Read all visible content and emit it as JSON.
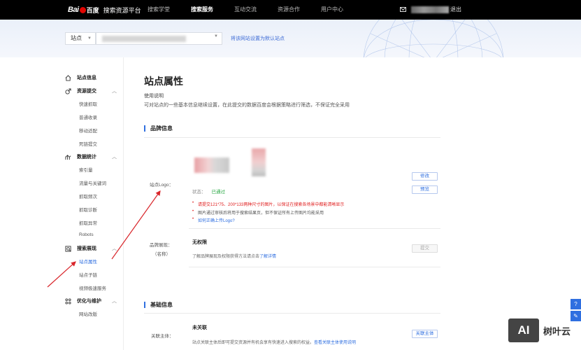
{
  "header": {
    "logo_bai": "Bai",
    "logo_du": "百度",
    "product_title": "搜索资源平台",
    "nav": [
      "搜索学堂",
      "搜索服务",
      "互动交流",
      "资源合作",
      "用户中心"
    ],
    "active_nav": "搜索服务",
    "logout": "退出"
  },
  "site_bar": {
    "select_label": "站点",
    "set_default_link": "将该网站设置为默认站点"
  },
  "sidebar": {
    "groups": [
      {
        "label": "站点信息",
        "icon": "home-icon",
        "items": []
      },
      {
        "label": "资源提交",
        "icon": "upload-icon",
        "items": [
          "快速抓取",
          "普通收录",
          "移动适配",
          "死链提交"
        ]
      },
      {
        "label": "数据统计",
        "icon": "chart-icon",
        "items": [
          "索引量",
          "流量与关键词",
          "抓取频次",
          "抓取诊断",
          "抓取异常",
          "Robots"
        ]
      },
      {
        "label": "搜索展现",
        "icon": "display-icon",
        "items": [
          "站点属性",
          "站点子链",
          "视频极速服务"
        ]
      },
      {
        "label": "优化与维护",
        "icon": "tools-icon",
        "items": [
          "网站改版"
        ]
      }
    ],
    "active_item": "站点属性"
  },
  "main": {
    "title": "站点属性",
    "usage_title": "使用说明",
    "usage_desc": "可对站点的一些基本信息继续设置，在此提交的数据百度会根据策略进行筛选，不保证完全采用",
    "brand_section": "品牌信息",
    "logo_label": "站点Logo：",
    "status_label": "状态：",
    "status_value": "已通过",
    "notes": [
      "请提交121*75、200*133两种尺寸的图片，以保证在搜索各场景中都能清晰显示",
      "图片通过审核后将用于搜索结果页，但不保证所有上传图片均能采用",
      "如何正确上传Logo?"
    ],
    "edit_button": "修改",
    "preview_button": "预览",
    "brand_display_label": "品牌展现：",
    "brand_display_sub": "（名称）",
    "no_permission": "无权限",
    "permission_desc_prefix": "了解品牌展现及权限获得方法请点击",
    "permission_desc_link": "了解详情",
    "submit_button": "提交",
    "basic_section": "基础信息",
    "related_label": "关联主体：",
    "related_status": "未关联",
    "related_desc_prefix": "站点关联主体后即可提交资源并有机会享有快速进入搜索的权益。",
    "related_desc_link": "查看关联主体使用说明",
    "related_button": "关联主体"
  },
  "side_tools": [
    "?",
    "✎"
  ],
  "watermark": {
    "box": "AI",
    "text": "树叶云"
  },
  "colors": {
    "accent": "#2f6fe0",
    "topbar": "#000000",
    "success": "#2aa845",
    "warning": "#e02020",
    "annotation_arrow": "#d9262b"
  }
}
